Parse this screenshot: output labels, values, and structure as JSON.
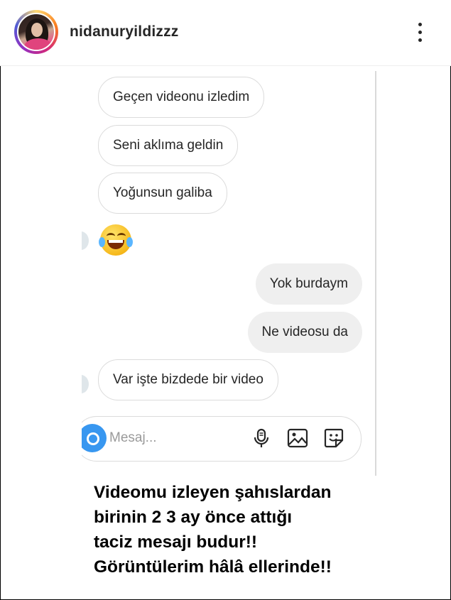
{
  "header": {
    "username": "nidanuryildizzz"
  },
  "icons": {
    "more": "more-options-icon",
    "avatar": "profile-avatar",
    "camera": "camera-icon",
    "mic": "microphone-icon",
    "gallery": "gallery-icon",
    "sticker": "sticker-icon",
    "emoji": "tears-of-joy-emoji"
  },
  "messages": [
    {
      "side": "incoming",
      "text": "Geçen videonu izledim"
    },
    {
      "side": "incoming",
      "text": "Seni aklıma geldin"
    },
    {
      "side": "incoming",
      "text": "Yoğunsun galiba"
    },
    {
      "side": "incoming",
      "emoji": "😂"
    },
    {
      "side": "outgoing",
      "text": "Yok burdaym"
    },
    {
      "side": "outgoing",
      "text": "Ne videosu da"
    },
    {
      "side": "incoming",
      "text": "Var işte bizdede bir video"
    }
  ],
  "composer": {
    "placeholder": "Mesaj..."
  },
  "caption": {
    "line1": "Videomu izleyen şahıslardan",
    "line2": "birinin 2 3 ay önce attığı",
    "line3": "taciz mesajı budur!!",
    "line4": "Görüntülerim hâlâ ellerinde!!"
  },
  "colors": {
    "story_ring": "#d62976",
    "camera_button": "#3897f0",
    "outgoing_bubble": "#efefef",
    "incoming_border": "#dbdbdb"
  }
}
